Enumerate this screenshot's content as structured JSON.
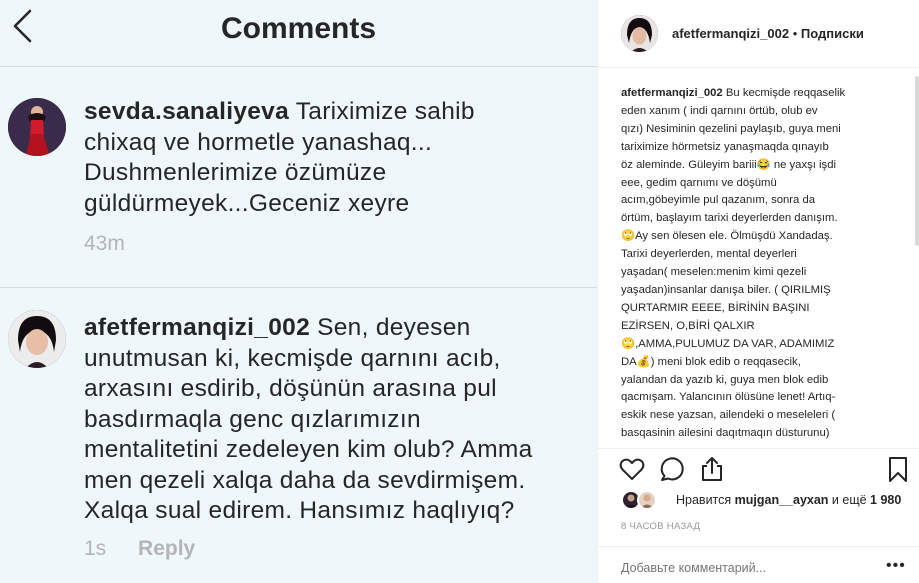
{
  "screenshot": {
    "title": "Comments",
    "comments": [
      {
        "username": "sevda.sanaliyeva",
        "text_lines": [
          "Tariximize sahib",
          "chixaq ve hormetle yanashaq...",
          "Dushmenlerimize özümüze",
          "güldürmeyek...Geceniz xeyre"
        ],
        "time": "43m"
      },
      {
        "username": "afetfermanqizi_002",
        "text_lines": [
          "Sen, deyesen",
          "unutmusan ki, kecmişde qarnını acıb,",
          "arxasını esdirib, döşünün arasına pul",
          "basdırmaqla genc qızlarımızın",
          "mentalitetini zedeleyen kim olub? Amma",
          "men qezeli xalqa daha da sevdirmişem.",
          "Xalqa sual edirem. Hansımız haqlıyıq?"
        ],
        "time": "1s",
        "reply_label": "Reply"
      }
    ]
  },
  "post": {
    "author": "afetfermanqizi_002",
    "separator": "•",
    "follow_label": "Подписки",
    "caption_user": "afetfermanqizi_002",
    "caption_lines": [
      " Bu kecmişde reqqaselik",
      "eden xanım ( indi qarnını örtüb, olub ev",
      "qızı) Nesiminin qezelini paylaşıb, guya meni",
      "tariximize hörmetsiz yanaşmaqda qınayıb",
      "öz aleminde. Güleyim bariii😂 ne yaxşı işdi",
      "eee, gedim qarnımı ve döşümü",
      "acım,göbeyimle pul qazanım, sonra da",
      "örtüm, başlayım tarixi deyerlerden danışım.",
      "🙄Ay sen ölesen ele. Ölmüşdü Xandadaş.",
      "Tarixi deyerlerden, mental deyerleri",
      "yaşadan( meselen:menim kimi qezeli",
      "yaşadan)insanlar danışa biler. ( QIRILMIŞ",
      "QURTARMIR EEEE, BİRİNİN BAŞINI",
      "EZİRSEN, O,BİRİ QALXIR",
      "🙄,AMMA,PULUMUZ DA VAR, ADAMIMIZ",
      "DA💰) meni blok edib o reqqasecik,",
      "yalandan da yazıb ki, guya men blok edib",
      "qacmışam. Yalancının ölüsüne lenet! Artıq-",
      "eskik nese yazsan, ailendeki o meseleleri (",
      "basqasinin ailesini daqıtmaqın düsturunu)"
    ],
    "likes_prefix": "Нравится ",
    "likes_user": "mujgan__ayxan",
    "likes_mid": " и ещё ",
    "likes_count": "1 980",
    "time_ago": "8 ЧАСОВ НАЗАД",
    "add_comment_placeholder": "Добавьте комментарий...",
    "more_label": "•••",
    "colors": {
      "text": "#262626",
      "muted": "#999999",
      "screenshot_bg": "#eef7fa"
    },
    "icons": [
      "heart-icon",
      "comment-icon",
      "share-icon",
      "bookmark-icon"
    ]
  }
}
